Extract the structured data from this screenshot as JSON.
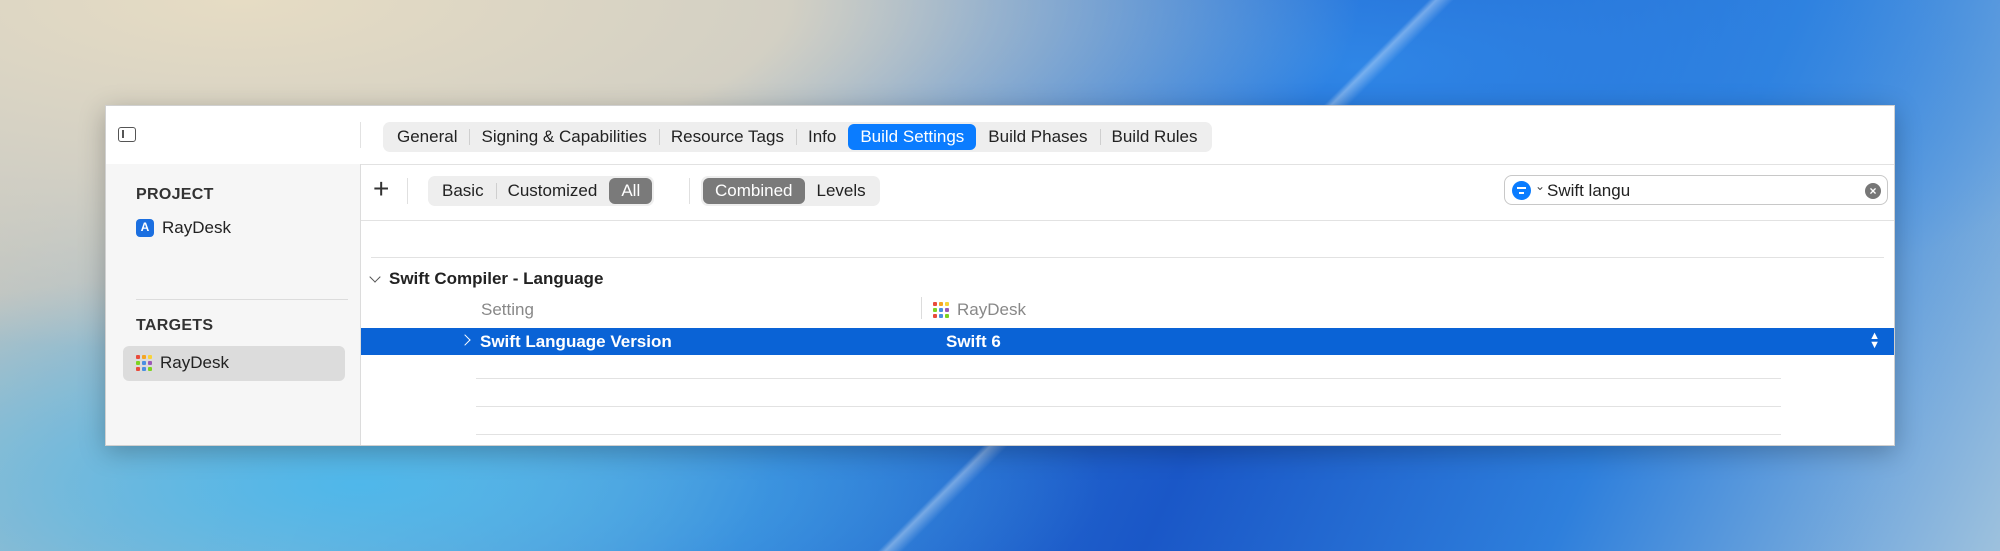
{
  "tabs": [
    "General",
    "Signing & Capabilities",
    "Resource Tags",
    "Info",
    "Build Settings",
    "Build Phases",
    "Build Rules"
  ],
  "active_tab": "Build Settings",
  "navigator": {
    "project_header": "PROJECT",
    "project_name": "RayDesk",
    "targets_header": "TARGETS",
    "target_name": "RayDesk"
  },
  "toolbar": {
    "add_label": "+",
    "filter_options": [
      "Basic",
      "Customized",
      "All"
    ],
    "active_filter": "All",
    "view_options": [
      "Combined",
      "Levels"
    ],
    "active_view": "Combined",
    "search_value": "Swift langu"
  },
  "settings": {
    "group_title": "Swift Compiler - Language",
    "col_setting": "Setting",
    "col_target": "RayDesk",
    "rows": [
      {
        "setting": "Swift Language Version",
        "value": "Swift 6"
      }
    ]
  },
  "colors": {
    "accent": "#0a7cff",
    "selection": "#0a63d6",
    "segment_active": "#7a7a7a",
    "app_icon_dots": [
      "#e94b3c",
      "#f5a623",
      "#f8d33a",
      "#7ed321",
      "#4a90e2",
      "#9b59b6",
      "#e94b3c",
      "#4a90e2",
      "#7ed321"
    ]
  }
}
